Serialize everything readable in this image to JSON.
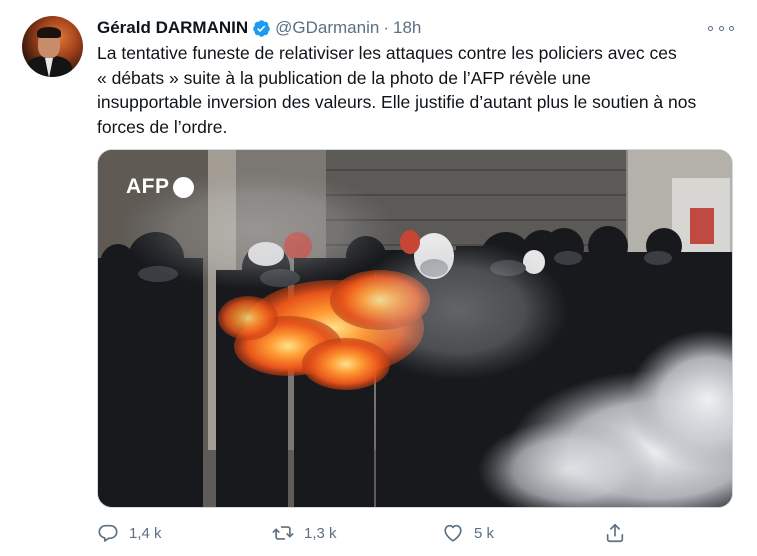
{
  "author": {
    "name": "Gérald DARMANIN",
    "handle": "@GDarmanin",
    "separator": "·",
    "time": "18h"
  },
  "tweet": {
    "text": "La tentative funeste de relativiser les attaques contre les policiers avec ces\n« débats » suite à la publication de la photo de l’AFP révèle une\ninsupportable inversion des valeurs. Elle justifie d’autant plus le soutien à nos\nforces de l’ordre."
  },
  "media": {
    "watermark": "AFP"
  },
  "actions": {
    "reply_count": "1,4 k",
    "retweet_count": "1,3 k",
    "like_count": "5 k"
  },
  "icons": {
    "verified": "verified-badge-icon",
    "more": "more-icon",
    "reply": "reply-icon",
    "retweet": "retweet-icon",
    "like": "heart-icon",
    "share": "share-icon"
  },
  "colors": {
    "verified": "#1d9bf0",
    "secondary_text": "#5b7083",
    "primary_text": "#0f1419"
  }
}
